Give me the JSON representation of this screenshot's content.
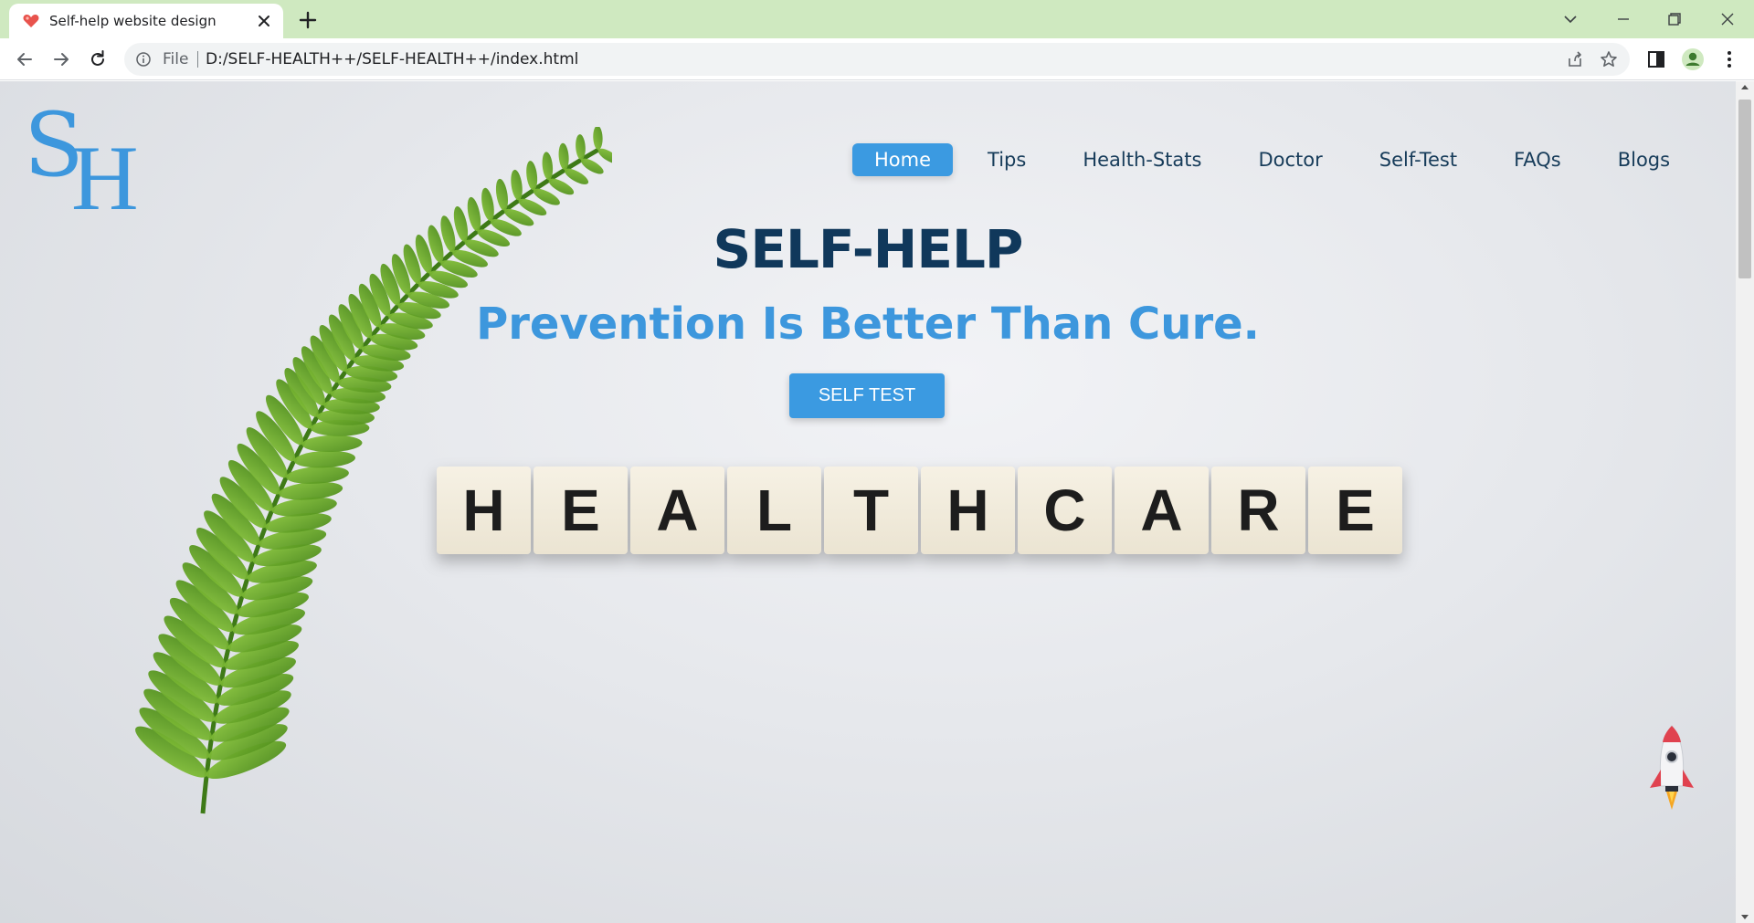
{
  "browser": {
    "tab_title": "Self-help website design",
    "omnibox_scheme": "File",
    "url": "D:/SELF-HEALTH++/SELF-HEALTH++/index.html"
  },
  "site": {
    "logo_letters": [
      "S",
      "H"
    ],
    "nav": [
      "Home",
      "Tips",
      "Health-Stats",
      "Doctor",
      "Self-Test",
      "FAQs",
      "Blogs"
    ],
    "active_nav": "Home",
    "hero_title": "SELF-HELP",
    "hero_subtitle": "Prevention Is Better Than Cure.",
    "hero_button": "SELF TEST",
    "tiles": [
      "H",
      "E",
      "A",
      "L",
      "T",
      "H",
      "C",
      "A",
      "R",
      "E"
    ]
  },
  "colors": {
    "accent": "#3b9ae1",
    "title": "#10385b",
    "tab_strip": "#cfe9c0"
  },
  "icons": [
    "heart-favicon-icon",
    "close-icon",
    "plus-icon",
    "chevron-down-icon",
    "minimize-icon",
    "restore-icon",
    "window-close-icon",
    "back-icon",
    "forward-icon",
    "reload-icon",
    "info-icon",
    "share-icon",
    "star-icon",
    "side-panel-icon",
    "profile-icon",
    "menu-dots-icon",
    "rocket-icon"
  ]
}
